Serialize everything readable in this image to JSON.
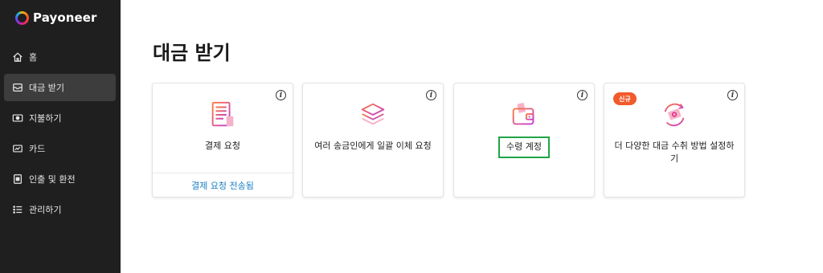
{
  "brand": {
    "name": "Payoneer"
  },
  "nav": {
    "items": [
      {
        "label": "홈",
        "icon": "home-icon"
      },
      {
        "label": "대금 받기",
        "icon": "inbox-icon",
        "active": true
      },
      {
        "label": "지불하기",
        "icon": "payment-icon"
      },
      {
        "label": "카드",
        "icon": "card-icon"
      },
      {
        "label": "인출 및 환전",
        "icon": "withdraw-icon"
      },
      {
        "label": "관리하기",
        "icon": "list-icon"
      }
    ]
  },
  "page": {
    "title": "대금 받기"
  },
  "cards": [
    {
      "label": "결제 요청",
      "icon": "invoice-icon",
      "link": "결제 요청 전송됨"
    },
    {
      "label": "여러 송금인에게 일괄 이체 요청",
      "icon": "stack-icon"
    },
    {
      "label": "수령 계정",
      "icon": "wallet-icon",
      "highlighted": true
    },
    {
      "label": "더 다양한 대금 수취 방법 설정하기",
      "icon": "money-exchange-icon",
      "badge": "신규"
    }
  ],
  "info_symbol": "i",
  "colors": {
    "sidebar_bg": "#1f1f1f",
    "link": "#1b7fc4",
    "badge": "#f15a2b",
    "highlight_border": "#22a447"
  }
}
